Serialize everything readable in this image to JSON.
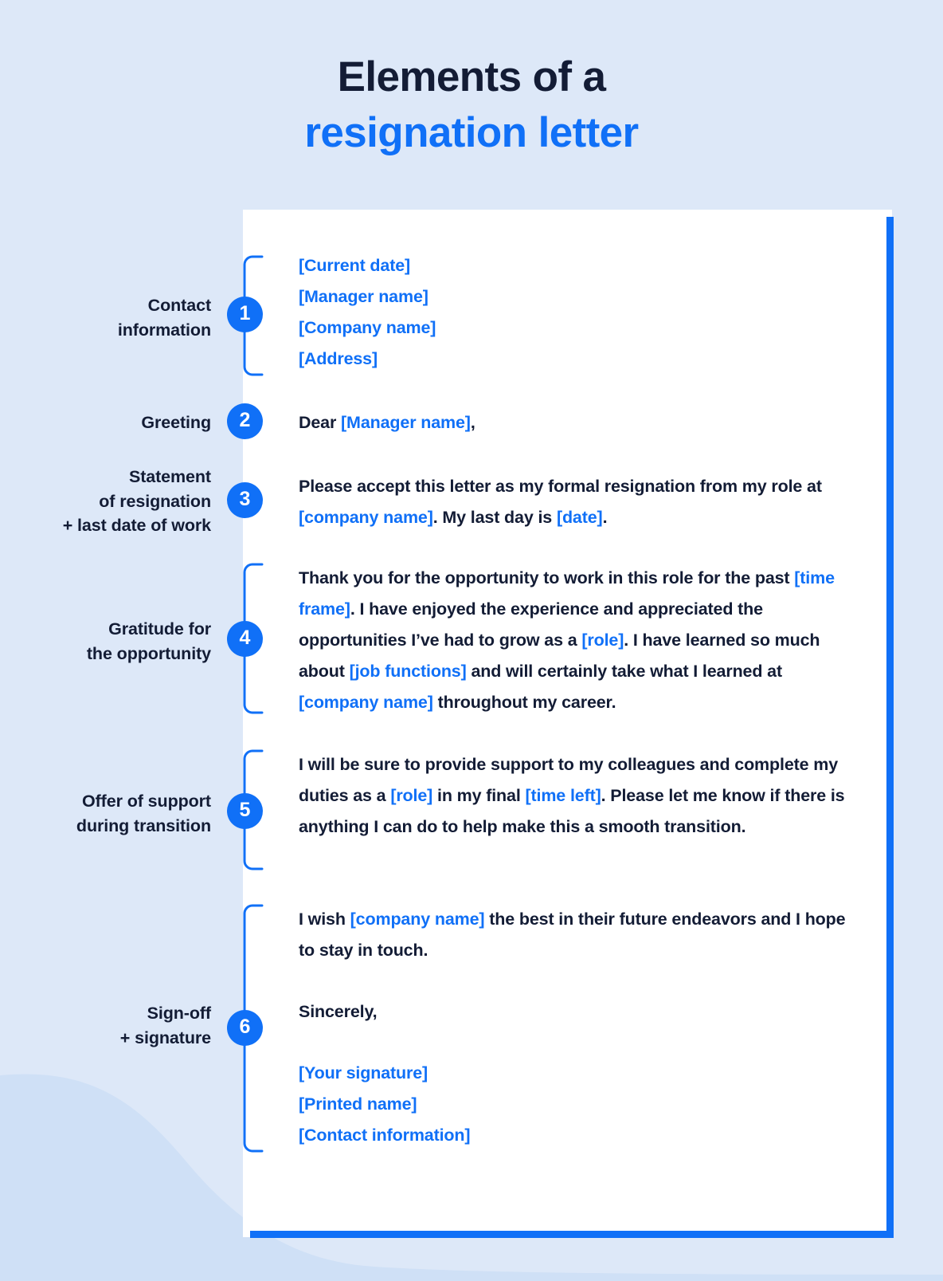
{
  "theme": {
    "background": "#dde8f8",
    "accent": "#1070f7",
    "ink": "#131c35",
    "card": "#ffffff",
    "wave": "#cfe0f6"
  },
  "heading": {
    "line1": "Elements of a",
    "line2": "resignation letter"
  },
  "sections": [
    {
      "number": "1",
      "label_line1": "Contact",
      "label_line2": "information",
      "lines": [
        "[Current date]",
        "[Manager name]",
        "[Company name]",
        "[Address]"
      ]
    },
    {
      "number": "2",
      "label_line1": "Greeting",
      "label_line2": "",
      "body_parts": [
        {
          "text": "Dear ",
          "placeholder": false
        },
        {
          "text": "[Manager name]",
          "placeholder": true
        },
        {
          "text": ",",
          "placeholder": false
        }
      ]
    },
    {
      "number": "3",
      "label_line1": "Statement",
      "label_line2": "of resignation",
      "label_line3": "+ last date of work",
      "body_parts": [
        {
          "text": "Please accept this letter as my formal resignation from my role at ",
          "placeholder": false
        },
        {
          "text": "[company name]",
          "placeholder": true
        },
        {
          "text": ". My last day is ",
          "placeholder": false
        },
        {
          "text": "[date]",
          "placeholder": true
        },
        {
          "text": ".",
          "placeholder": false
        }
      ]
    },
    {
      "number": "4",
      "label_line1": "Gratitude for",
      "label_line2": "the opportunity",
      "body_parts": [
        {
          "text": "Thank you for the opportunity to work in this role for the past ",
          "placeholder": false
        },
        {
          "text": "[time frame]",
          "placeholder": true
        },
        {
          "text": ". I have enjoyed the experience and appreciated the opportunities I’ve had to grow as a ",
          "placeholder": false
        },
        {
          "text": "[role]",
          "placeholder": true
        },
        {
          "text": ". I have learned so much about ",
          "placeholder": false
        },
        {
          "text": "[job functions]",
          "placeholder": true
        },
        {
          "text": " and will certainly take what I learned at ",
          "placeholder": false
        },
        {
          "text": "[company name]",
          "placeholder": true
        },
        {
          "text": " throughout my career.",
          "placeholder": false
        }
      ]
    },
    {
      "number": "5",
      "label_line1": "Offer of support",
      "label_line2": "during transition",
      "body_parts": [
        {
          "text": "I will be sure to provide support to my colleagues and complete my duties as a ",
          "placeholder": false
        },
        {
          "text": "[role]",
          "placeholder": true
        },
        {
          "text": " in my final ",
          "placeholder": false
        },
        {
          "text": "[time left]",
          "placeholder": true
        },
        {
          "text": ". Please let me know if there is anything I can do to help make this a smooth transition.",
          "placeholder": false
        }
      ]
    },
    {
      "number": "6",
      "label_line1": "Sign-off",
      "label_line2": "+ signature",
      "closing_parts": [
        {
          "text": "I wish ",
          "placeholder": false
        },
        {
          "text": "[company name]",
          "placeholder": true
        },
        {
          "text": " the best in their future endeavors and I hope to stay in touch.",
          "placeholder": false
        }
      ],
      "signoff": "Sincerely,",
      "signature_lines": [
        "[Your signature]",
        "[Printed name]",
        "[Contact information]"
      ]
    }
  ]
}
